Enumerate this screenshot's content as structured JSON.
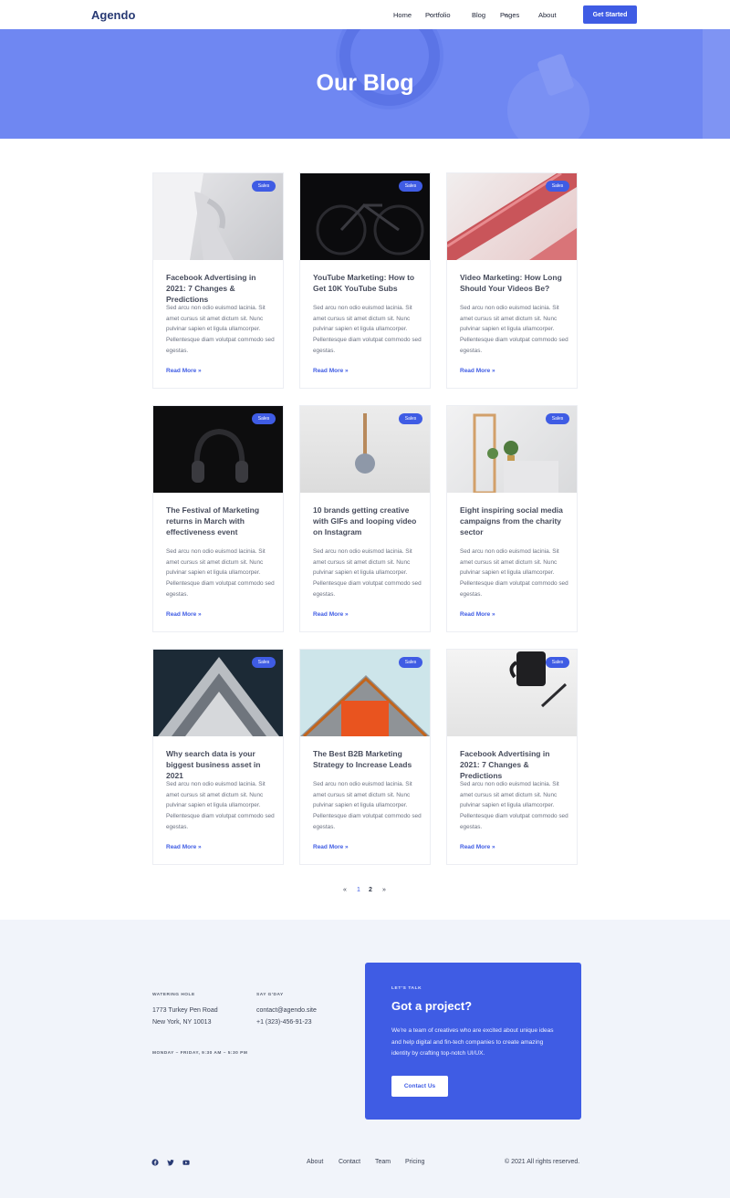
{
  "header": {
    "logo": "Agendo",
    "nav": [
      {
        "label": "Home"
      },
      {
        "label": "Portfolio",
        "chevron": "⌄"
      },
      {
        "label": "Blog"
      },
      {
        "label": "Pages",
        "chevron": "⌄"
      },
      {
        "label": "About"
      }
    ],
    "cta_label": "Get Started"
  },
  "hero": {
    "title": "Our Blog"
  },
  "posts": [
    {
      "badge": "Sales",
      "title": "Facebook Advertising in 2021: 7 Changes & Predictions",
      "excerpt": "Sed arcu non odio euismod lacinia. Sit amet cursus sit amet dictum sit. Nunc pulvinar sapien et ligula ullamcorper. Pellentesque diam volutpat commodo sed egestas.",
      "more": "Read More »"
    },
    {
      "badge": "Sales",
      "title": "YouTube Marketing: How to Get 10K YouTube Subs",
      "excerpt": "Sed arcu non odio euismod lacinia. Sit amet cursus sit amet dictum sit. Nunc pulvinar sapien et ligula ullamcorper. Pellentesque diam volutpat commodo sed egestas.",
      "more": "Read More »"
    },
    {
      "badge": "Sales",
      "title": "Video Marketing: How Long Should Your Videos Be?",
      "excerpt": "Sed arcu non odio euismod lacinia. Sit amet cursus sit amet dictum sit. Nunc pulvinar sapien et ligula ullamcorper. Pellentesque diam volutpat commodo sed egestas.",
      "more": "Read More »"
    },
    {
      "badge": "Sales",
      "title": "The Festival of Marketing returns in March with effectiveness event",
      "excerpt": "Sed arcu non odio euismod lacinia. Sit amet cursus sit amet dictum sit. Nunc pulvinar sapien et ligula ullamcorper. Pellentesque diam volutpat commodo sed egestas.",
      "more": "Read More »"
    },
    {
      "badge": "Sales",
      "title": "10 brands getting creative with GIFs and looping video on Instagram",
      "excerpt": "Sed arcu non odio euismod lacinia. Sit amet cursus sit amet dictum sit. Nunc pulvinar sapien et ligula ullamcorper. Pellentesque diam volutpat commodo sed egestas.",
      "more": "Read More »"
    },
    {
      "badge": "Sales",
      "title": "Eight inspiring social media campaigns from the charity sector",
      "excerpt": "Sed arcu non odio euismod lacinia. Sit amet cursus sit amet dictum sit. Nunc pulvinar sapien et ligula ullamcorper. Pellentesque diam volutpat commodo sed egestas.",
      "more": "Read More »"
    },
    {
      "badge": "Sales",
      "title": "Why search data is your biggest business asset in 2021",
      "excerpt": "Sed arcu non odio euismod lacinia. Sit amet cursus sit amet dictum sit. Nunc pulvinar sapien et ligula ullamcorper. Pellentesque diam volutpat commodo sed egestas.",
      "more": "Read More »"
    },
    {
      "badge": "Sales",
      "title": "The Best B2B Marketing Strategy to Increase Leads",
      "excerpt": "Sed arcu non odio euismod lacinia. Sit amet cursus sit amet dictum sit. Nunc pulvinar sapien et ligula ullamcorper. Pellentesque diam volutpat commodo sed egestas.",
      "more": "Read More »"
    },
    {
      "badge": "Sales",
      "title": "Facebook Advertising in 2021: 7 Changes & Predictions",
      "excerpt": "Sed arcu non odio euismod lacinia. Sit amet cursus sit amet dictum sit. Nunc pulvinar sapien et ligula ullamcorper. Pellentesque diam volutpat commodo sed egestas.",
      "more": "Read More »"
    }
  ],
  "pagination": {
    "prev": "«",
    "pages": [
      "1",
      "2"
    ],
    "current": "2",
    "next": "»"
  },
  "footer": {
    "address_label": "WATERING HOLE",
    "address_line1": "1773 Turkey Pen Road",
    "address_line2": "New York, NY 10013",
    "contact_label": "SAY G'DAY",
    "email": "contact@agendo.site",
    "phone": "+1 (323)-456-91-23",
    "hours": "MONDAY – FRIDAY, 9:30 AM – 5:30 PM",
    "cta": {
      "label": "LET'S TALK",
      "heading": "Got a project?",
      "text": "We're a team of creatives who are excited about unique ideas and help digital and fin-tech companies to create amazing identity by crafting top-notch UI/UX.",
      "button": "Contact Us"
    },
    "social": [
      "facebook-icon",
      "twitter-icon",
      "youtube-icon"
    ],
    "links": [
      "About",
      "Contact",
      "Team",
      "Pricing"
    ],
    "copyright": "© 2021 All rights reserved."
  },
  "colors": {
    "accent": "#3f5ce4",
    "hero": "#6f87f2",
    "footer_bg": "#f1f4fa"
  }
}
